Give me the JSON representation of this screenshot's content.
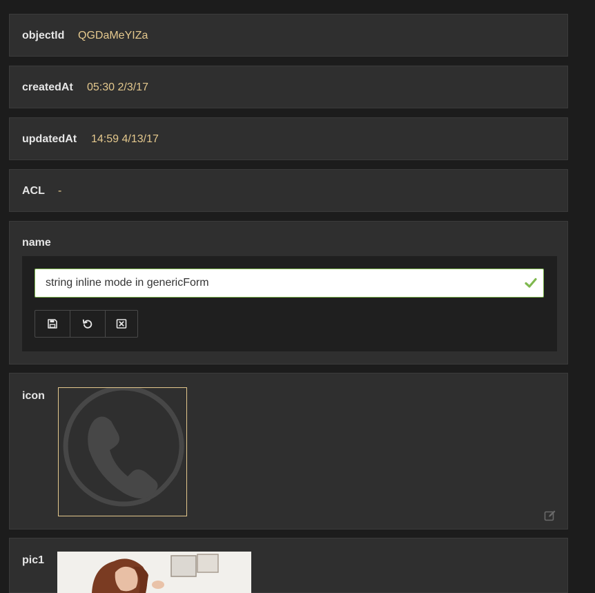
{
  "fields": {
    "objectId": {
      "label": "objectId",
      "value": "QGDaMeYIZa"
    },
    "createdAt": {
      "label": "createdAt",
      "value": "05:30 2/3/17"
    },
    "updatedAt": {
      "label": "updatedAt",
      "value": "14:59 4/13/17"
    },
    "acl": {
      "label": "ACL",
      "value": "-"
    }
  },
  "name": {
    "label": "name",
    "input_value": "string inline mode in genericForm",
    "buttons": [
      "save-icon",
      "undo-icon",
      "cancel-icon"
    ]
  },
  "icon": {
    "label": "icon",
    "image": "phone-icon"
  },
  "pic1": {
    "label": "pic1",
    "image": "photo"
  },
  "colors": {
    "background": "#1c1c1c",
    "panel": "#2f2f2f",
    "value_text": "#e5c98e",
    "input_border": "#7fb84f"
  }
}
